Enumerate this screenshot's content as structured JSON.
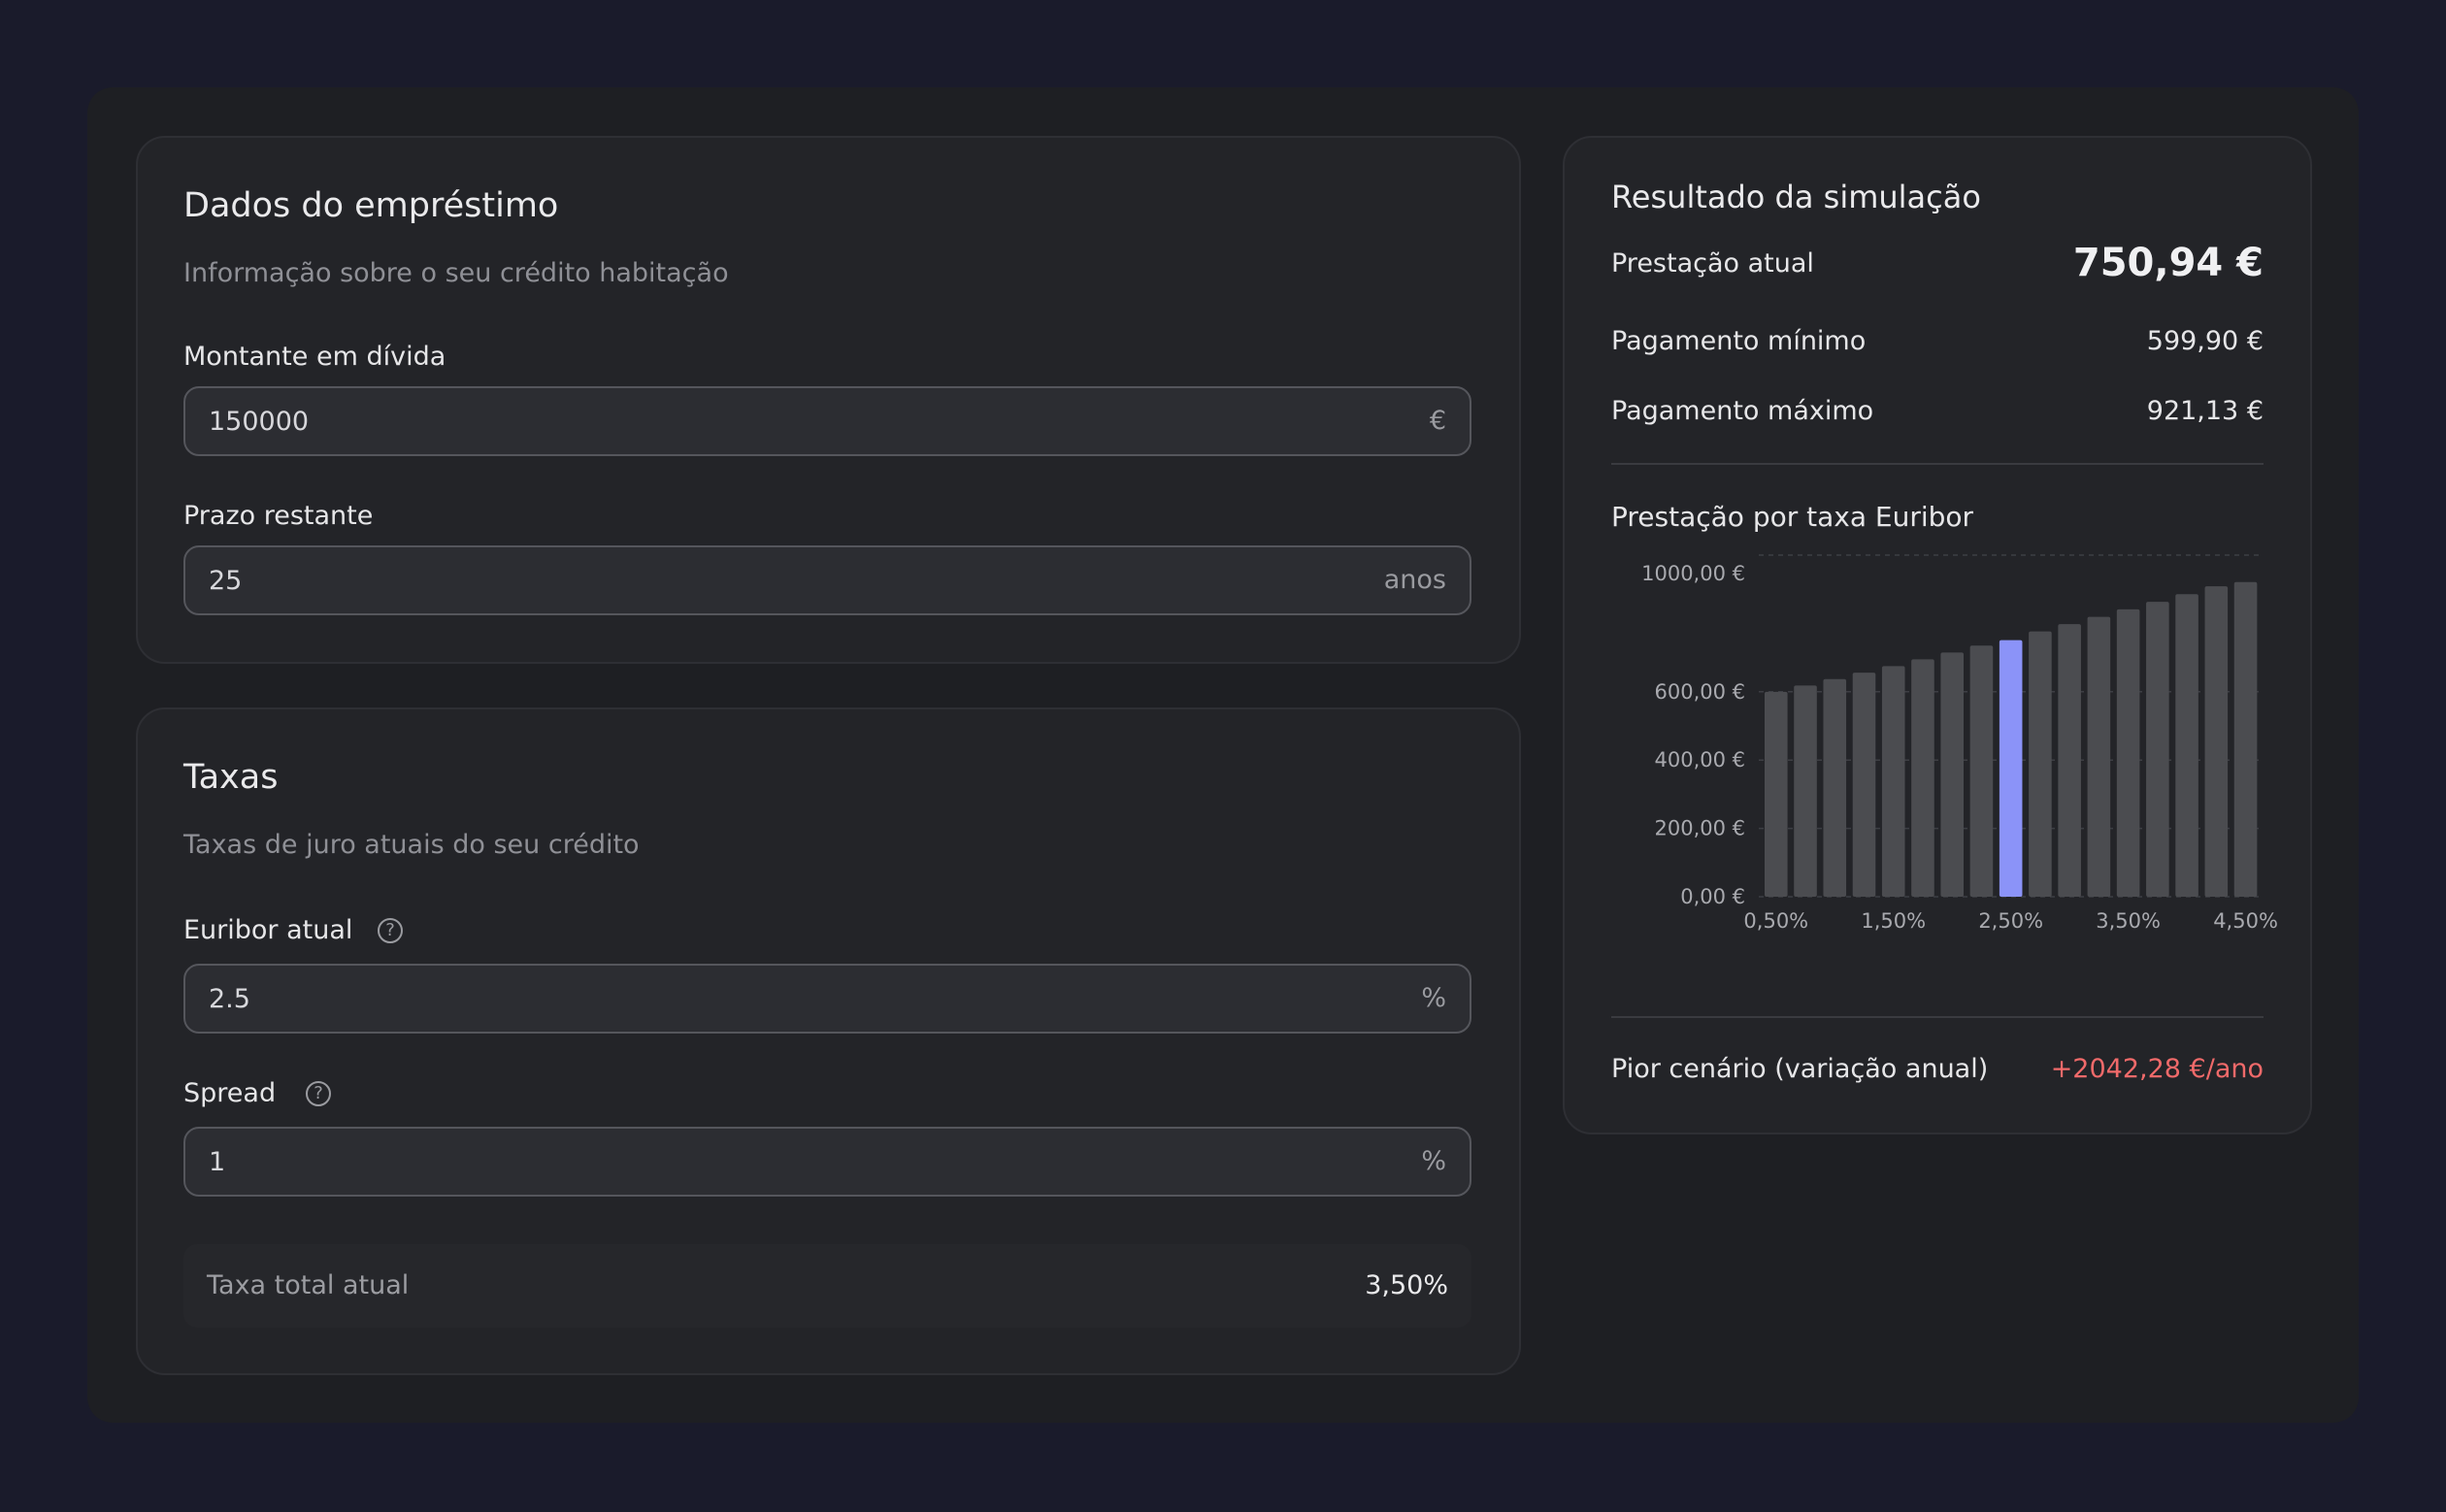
{
  "loan": {
    "title": "Dados do empréstimo",
    "subtitle": "Informação sobre o seu crédito habitação",
    "amount_label": "Montante em dívida",
    "amount_value": "150000",
    "amount_suffix": "€",
    "term_label": "Prazo restante",
    "term_value": "25",
    "term_suffix": "anos"
  },
  "rates": {
    "title": "Taxas",
    "subtitle": "Taxas de juro atuais do seu crédito",
    "euribor_label": "Euribor atual",
    "euribor_value": "2.5",
    "euribor_suffix": "%",
    "spread_label": "Spread",
    "spread_value": "1",
    "spread_suffix": "%",
    "help_icon": "question-circle-icon",
    "total_label": "Taxa total atual",
    "total_value": "3,50%"
  },
  "result": {
    "title": "Resultado da simulação",
    "current_label": "Prestação atual",
    "current_value": "750,94 €",
    "min_label": "Pagamento mínimo",
    "min_value": "599,90 €",
    "max_label": "Pagamento máximo",
    "max_value": "921,13 €",
    "chart_title": "Prestação por taxa Euribor",
    "worst_label": "Pior cenário (variação anual)",
    "worst_value": "+2042,28 €/ano"
  },
  "colors": {
    "highlight_bar": "#8b93f8",
    "bar": "#4b4c50",
    "negative": "#f06a6a",
    "background": "#1a1b2b"
  },
  "chart_data": {
    "type": "bar",
    "categories": [
      "0,50%",
      "0,75%",
      "1,00%",
      "1,25%",
      "1,50%",
      "1,75%",
      "2,00%",
      "2,25%",
      "2,50%",
      "2,75%",
      "3,00%",
      "3,25%",
      "3,50%",
      "3,75%",
      "4,00%",
      "4,25%",
      "4,50%"
    ],
    "tick_labels_shown": [
      "0,50%",
      "1,50%",
      "2,50%",
      "3,50%",
      "4,50%"
    ],
    "values": [
      599.9,
      618.2,
      636.9,
      655.9,
      675.2,
      694.9,
      714.8,
      735.1,
      750.94,
      776.6,
      797.8,
      819.4,
      841.2,
      863.4,
      885.8,
      908.6,
      921.13
    ],
    "highlight_index": 8,
    "y_ticks": [
      "0,00 €",
      "200,00 €",
      "400,00 €",
      "600,00 €",
      "1000,00 €"
    ],
    "y_tick_values": [
      0,
      200,
      400,
      600,
      1000
    ],
    "ylim": [
      0,
      1000
    ],
    "grid": true
  }
}
